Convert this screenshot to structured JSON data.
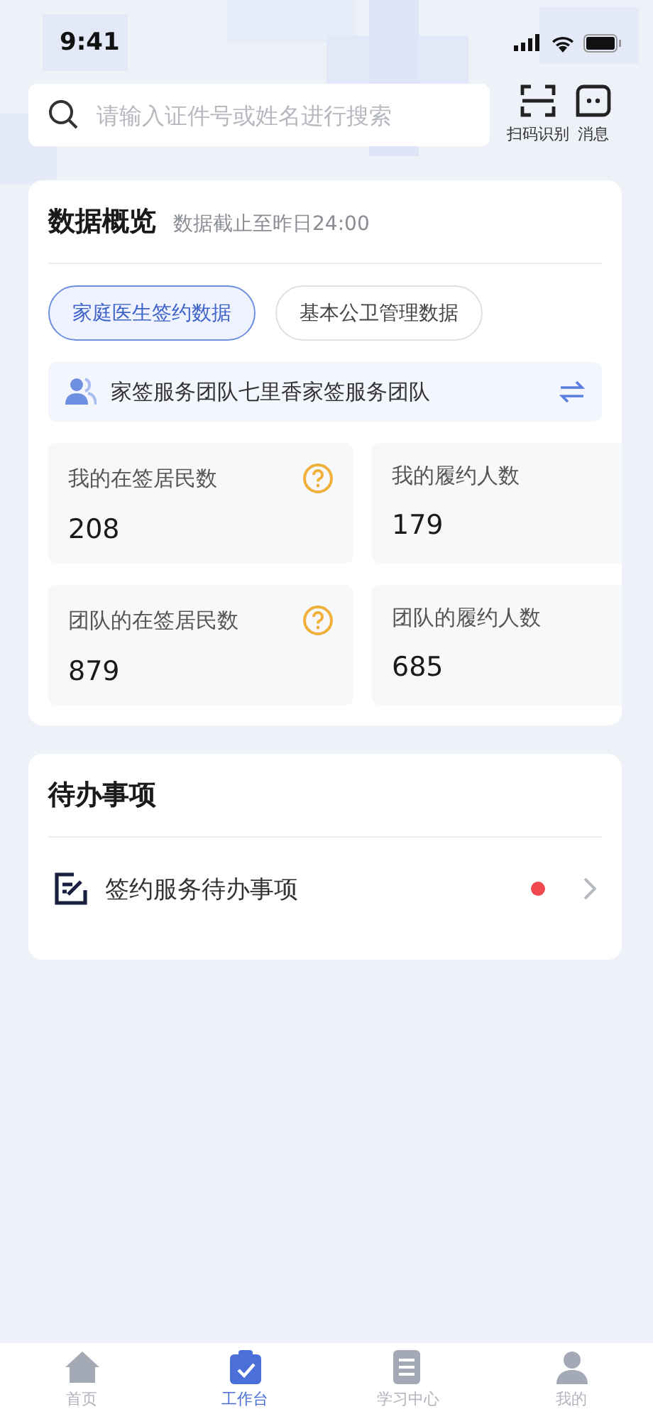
{
  "status_bar": {
    "time": "9:41"
  },
  "search": {
    "placeholder": "请输入证件号或姓名进行搜索"
  },
  "header_actions": [
    {
      "kind": "scan",
      "label": "扫码识别"
    },
    {
      "kind": "message",
      "label": "消息"
    }
  ],
  "overview": {
    "title": "数据概览",
    "subtitle": "数据截止至昨日24:00",
    "tabs": [
      {
        "label": "家庭医生签约数据",
        "selected": true
      },
      {
        "label": "基本公卫管理数据",
        "selected": false
      }
    ],
    "team": {
      "name": "家签服务团队七里香家签服务团队"
    },
    "stats": [
      {
        "label": "我的在签居民数",
        "value": "208",
        "help": true
      },
      {
        "label": "我的履约人数",
        "value": "179",
        "help": false
      },
      {
        "label": "团队的在签居民数",
        "value": "879",
        "help": true
      },
      {
        "label": "团队的履约人数",
        "value": "685",
        "help": false
      }
    ]
  },
  "todo": {
    "title": "待办事项",
    "items": [
      {
        "label": "签约服务待办事项",
        "unread": true
      }
    ]
  },
  "tab_bar": [
    {
      "kind": "home",
      "label": "首页",
      "selected": false
    },
    {
      "kind": "work",
      "label": "工作台",
      "selected": true
    },
    {
      "kind": "doc",
      "label": "学习中心",
      "selected": false
    },
    {
      "kind": "me",
      "label": "我的",
      "selected": false
    }
  ]
}
